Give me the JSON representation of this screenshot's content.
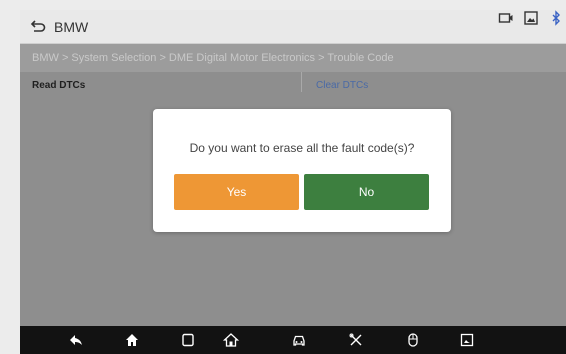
{
  "topbar": {
    "title": "BMW",
    "icons": [
      "back-icon",
      "camera-icon",
      "image-icon",
      "bluetooth-icon"
    ]
  },
  "breadcrumb": "BMW > System Selection > DME Digital Motor Electronics > Trouble Code",
  "tabs": [
    {
      "label": "Read DTCs"
    },
    {
      "label": "Clear DTCs"
    }
  ],
  "dialog": {
    "message": "Do you want to erase all the fault code(s)?",
    "yes_label": "Yes",
    "no_label": "No"
  },
  "navbar": {
    "icons": [
      "back-icon",
      "home-icon",
      "recent-apps-icon",
      "house-icon",
      "car-icon",
      "tools-icon",
      "mouse-icon",
      "screenshot-icon"
    ]
  },
  "colors": {
    "yes": "#ee9735",
    "no": "#3d7f3f",
    "link": "#4a6aa6",
    "navbar": "#121212"
  }
}
